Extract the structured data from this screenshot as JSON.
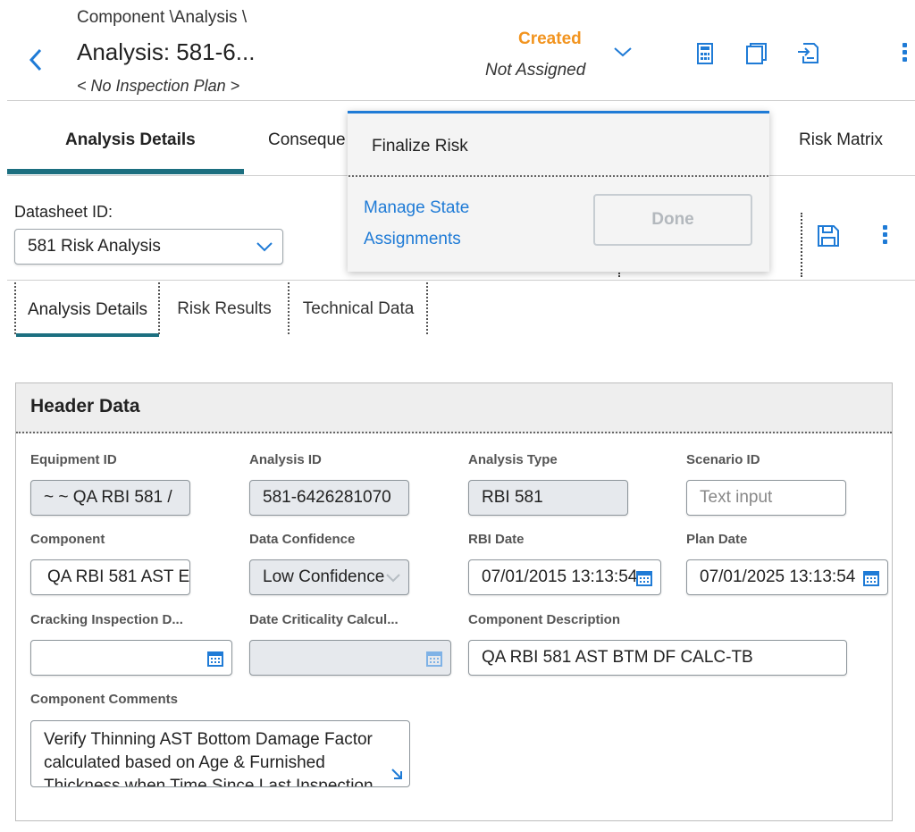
{
  "header": {
    "breadcrumb": "Component \\Analysis \\",
    "title": "Analysis: 581-6...",
    "subtitle": "< No Inspection Plan >",
    "state": "Created",
    "assignee": "Not Assigned",
    "icons": [
      "back-chevron-icon",
      "calculator-icon",
      "window-icon",
      "document-export-icon",
      "kebab-menu-icon"
    ]
  },
  "tabs": [
    {
      "label": "Analysis Details",
      "active": true
    },
    {
      "label": "Conseque"
    },
    {
      "label": "Risk Matrix"
    }
  ],
  "datasheet": {
    "label": "Datasheet ID:",
    "selected": "581 Risk Analysis"
  },
  "subtabs": [
    {
      "label": "Analysis Details",
      "active": true
    },
    {
      "label": "Risk Results"
    },
    {
      "label": "Technical Data"
    }
  ],
  "popup": {
    "item": "Finalize Risk",
    "link_line1": "Manage State",
    "link_line2": "Assignments",
    "done_label": "Done"
  },
  "section": {
    "title": "Header Data",
    "fields": {
      "equipment_id": {
        "label": "Equipment ID",
        "value": "~ ~ QA RBI 581 /"
      },
      "analysis_id": {
        "label": "Analysis ID",
        "value": "581-6426281070"
      },
      "analysis_type": {
        "label": "Analysis Type",
        "value": "RBI 581"
      },
      "scenario_id": {
        "label": "Scenario ID",
        "placeholder": "Text input"
      },
      "component": {
        "label": "Component",
        "value": "QA RBI 581 AST E"
      },
      "data_confidence": {
        "label": "Data Confidence",
        "value": "Low Confidence"
      },
      "rbi_date": {
        "label": "RBI Date",
        "value": "07/01/2015 13:13:54"
      },
      "plan_date": {
        "label": "Plan Date",
        "value": "07/01/2025 13:13:54"
      },
      "cracking_date": {
        "label": "Cracking Inspection D...",
        "value": ""
      },
      "date_criticality": {
        "label": "Date Criticality Calcul...",
        "value": ""
      },
      "component_description": {
        "label": "Component Description",
        "value": "QA RBI 581 AST BTM DF CALC-TB"
      },
      "component_comments": {
        "label": "Component Comments",
        "value": "Verify Thinning AST Bottom Damage Factor calculated based on Age & Furnished Thickness when Time Since Last Inspection"
      }
    }
  },
  "colors": {
    "accent": "#1f7bd6",
    "state": "#f2941f",
    "tab_underline": "#1c6f80"
  }
}
